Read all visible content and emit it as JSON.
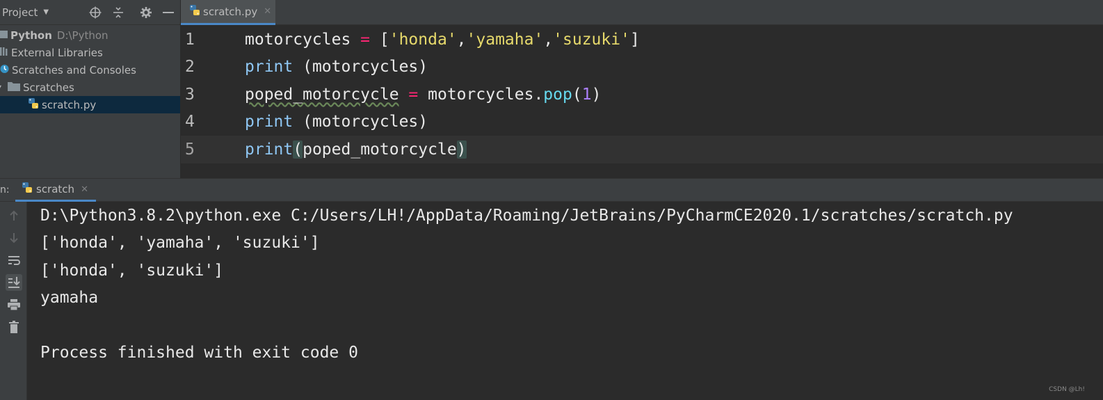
{
  "project_panel": {
    "title": "Project",
    "tree": [
      {
        "label": "Python",
        "path": "D:\\Python"
      },
      {
        "label": "External Libraries"
      },
      {
        "label": "Scratches and Consoles"
      },
      {
        "label": "Scratches"
      },
      {
        "label": "scratch.py"
      }
    ]
  },
  "editor": {
    "tab_label": "scratch.py",
    "close_glyph": "✕",
    "line_numbers": [
      "1",
      "2",
      "3",
      "4",
      "5"
    ],
    "code_tokens": {
      "l1": {
        "a": "motorcycles ",
        "op": "=",
        "b": " [",
        "s1": "'honda'",
        "c1": ",",
        "s2": "'yamaha'",
        "c2": ",",
        "s3": "'suzuki'",
        "end": "]"
      },
      "l2": {
        "fn": "print",
        "rest": " (motorcycles)"
      },
      "l3": {
        "a": "poped_motorcycle",
        "b": " ",
        "op": "=",
        "c": " motorcycles.",
        "m": "pop",
        "p1": "(",
        "n": "1",
        "p2": ")"
      },
      "l4": {
        "fn": "print",
        "rest": " (motorcycles)"
      },
      "l5": {
        "fn": "print",
        "p1": "(",
        "arg": "poped_motorcycle",
        "p2": ")"
      }
    }
  },
  "run_panel": {
    "label": "n:",
    "tab_label": "scratch",
    "close_glyph": "✕",
    "console_lines": [
      "D:\\Python3.8.2\\python.exe C:/Users/LH!/AppData/Roaming/JetBrains/PyCharmCE2020.1/scratches/scratch.py",
      "['honda', 'yamaha', 'suzuki']",
      "['honda', 'suzuki']",
      "yamaha",
      "",
      "Process finished with exit code 0"
    ]
  },
  "watermark": "CSDN @Lh!",
  "colors": {
    "accent": "#4a88c7",
    "string": "#e6d96b",
    "operator": "#f92672",
    "number": "#ae81ff",
    "builtin": "#8fc7f4",
    "method": "#66d9ef"
  }
}
